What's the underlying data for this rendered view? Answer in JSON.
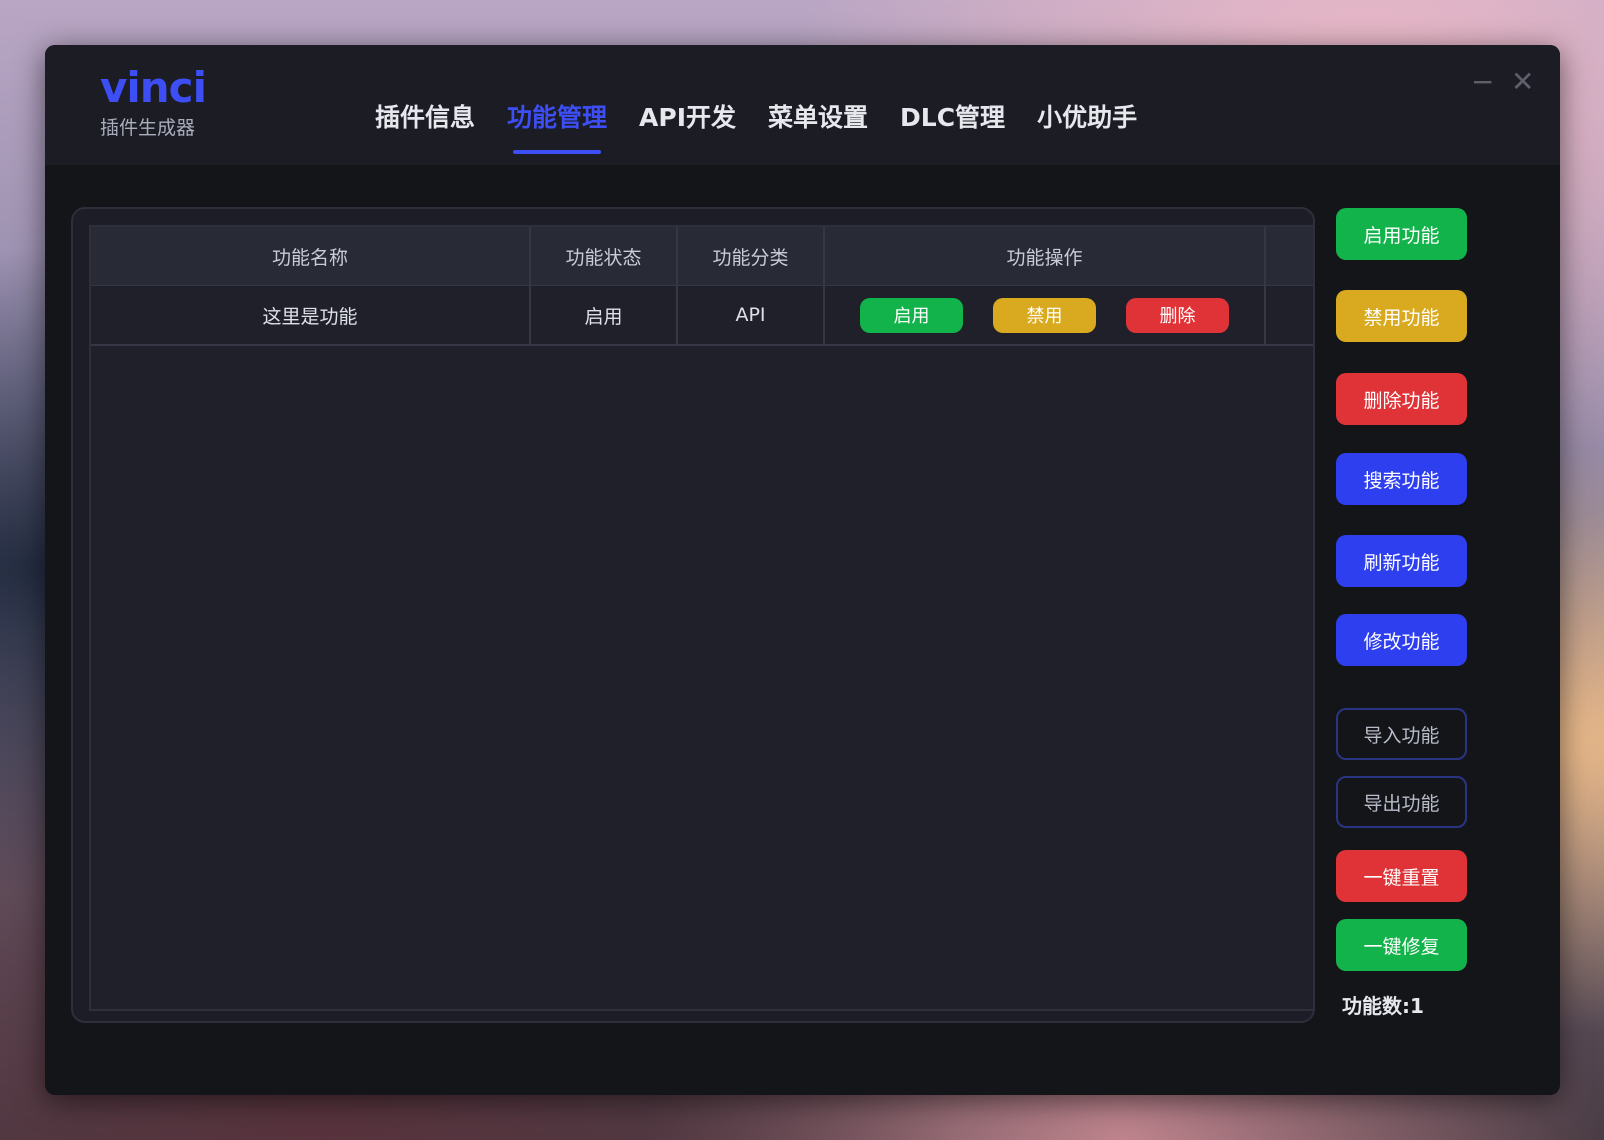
{
  "brand": {
    "name": "vinci",
    "subtitle": "插件生成器"
  },
  "tabs": [
    {
      "label": "插件信息",
      "active": false
    },
    {
      "label": "功能管理",
      "active": true
    },
    {
      "label": "API开发",
      "active": false
    },
    {
      "label": "菜单设置",
      "active": false
    },
    {
      "label": "DLC管理",
      "active": false
    },
    {
      "label": "小优助手",
      "active": false
    }
  ],
  "window": {
    "minimize_glyph": "−",
    "close_glyph": "✕"
  },
  "table": {
    "columns": [
      "功能名称",
      "功能状态",
      "功能分类",
      "功能操作"
    ],
    "rows": [
      {
        "name": "这里是功能",
        "status": "启用",
        "category": "API",
        "actions": {
          "enable": "启用",
          "disable": "禁用",
          "delete": "删除"
        }
      }
    ]
  },
  "sidebar": {
    "enable": "启用功能",
    "disable": "禁用功能",
    "delete": "删除功能",
    "search": "搜索功能",
    "refresh": "刷新功能",
    "modify": "修改功能",
    "import": "导入功能",
    "export": "导出功能",
    "reset": "一键重置",
    "repair": "一键修复"
  },
  "footer": {
    "count": "功能数:1"
  },
  "colors": {
    "accent": "#3d4ef4",
    "green": "#12b34a",
    "yellow": "#d9aa1f",
    "red": "#e03337",
    "blue": "#2e3ff0"
  }
}
